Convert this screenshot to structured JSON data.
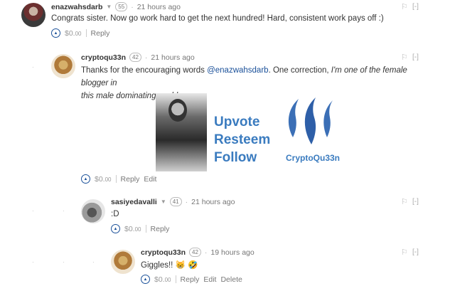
{
  "comments": [
    {
      "author": "enazwahsdarb",
      "rep": "55",
      "time": "21 hours ago",
      "body": "Congrats sister. Now go work hard to get the next hundred! Hard, consistent work pays off :)",
      "payout_main": "$0.",
      "payout_cents": "00",
      "actions": [
        "Reply"
      ]
    },
    {
      "author": "cryptoqu33n",
      "rep": "42",
      "time": "21 hours ago",
      "body_prefix": "Thanks for the encouraging words ",
      "body_mention": "@enazwahsdarb",
      "body_mid": ". One correction, ",
      "body_italic_1": "I'm one of the female blogger in",
      "body_italic_2": "this male dominating world.",
      "banner": {
        "line1": "Upvote",
        "line2": "Resteem",
        "line3": "Follow",
        "brand": "CryptoQu33n"
      },
      "payout_main": "$0.",
      "payout_cents": "00",
      "actions": [
        "Reply",
        "Edit"
      ]
    },
    {
      "author": "sasiyedavalli",
      "rep": "41",
      "time": "21 hours ago",
      "body": ":D",
      "payout_main": "$0.",
      "payout_cents": "00",
      "actions": [
        "Reply"
      ]
    },
    {
      "author": "cryptoqu33n",
      "rep": "42",
      "time": "19 hours ago",
      "body": "Giggles!! 😸 🤣",
      "payout_main": "$0.",
      "payout_cents": "00",
      "actions": [
        "Reply",
        "Edit",
        "Delete"
      ]
    }
  ],
  "ui": {
    "collapse_label": "[-]",
    "flag_icon": "flag-icon",
    "upvote_icon": "upvote-chevron-icon",
    "dropdown_icon": "caret-down-icon",
    "accent": "#1a5099",
    "banner_blue": "#3a7bbf"
  }
}
